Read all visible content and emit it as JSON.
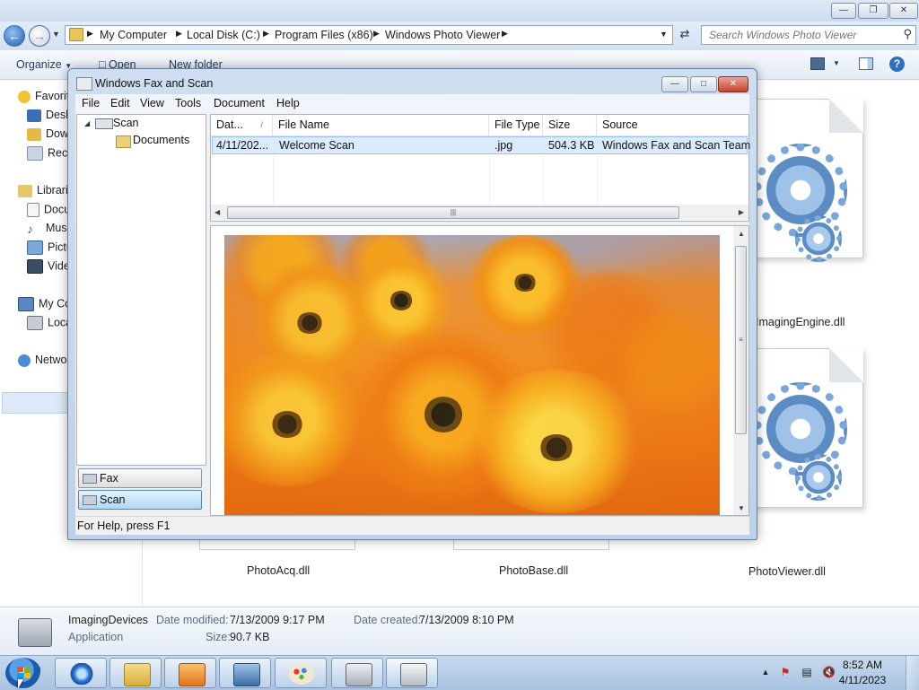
{
  "explorer": {
    "address": {
      "crumbs": [
        "My Computer",
        "Local Disk (C:)",
        "Program Files (x86)",
        "Windows Photo Viewer"
      ]
    },
    "search_placeholder": "Search Windows Photo Viewer",
    "toolbar": {
      "organize": "Organize",
      "open": "Open",
      "new_folder": "New folder"
    },
    "nav": {
      "favorites": "Favorites",
      "desktop": "Desktop",
      "downloads": "Downloads",
      "recent": "Recent Places",
      "libraries": "Libraries",
      "documents": "Documents",
      "music": "Music",
      "pictures": "Pictures",
      "videos": "Videos",
      "computer": "My Computer",
      "local_disk": "Local Disk (C:)",
      "network": "Network"
    },
    "files": {
      "imaging_engine": "ImagingEngine.dll",
      "photo_viewer": "PhotoViewer.dll",
      "photo_acq": "PhotoAcq.dll",
      "photo_base": "PhotoBase.dll"
    },
    "details": {
      "name": "ImagingDevices",
      "type": "Application",
      "modified_label": "Date modified:",
      "modified_value": "7/13/2009 9:17 PM",
      "created_label": "Date created:",
      "created_value": "7/13/2009 8:10 PM",
      "size_label": "Size:",
      "size_value": "90.7 KB"
    }
  },
  "fax": {
    "title": "Windows Fax and Scan",
    "menu": [
      "File",
      "Edit",
      "View",
      "Tools",
      "Document",
      "Help"
    ],
    "tree": {
      "scan": "Scan",
      "documents": "Documents"
    },
    "buttons": {
      "fax": "Fax",
      "scan": "Scan"
    },
    "columns": [
      "Dat...",
      "File Name",
      "File Type",
      "Size",
      "Source"
    ],
    "rows": [
      {
        "date": "4/11/202...",
        "name": "Welcome Scan",
        "type": ".jpg",
        "size": "504.3 KB",
        "source": "Windows Fax and Scan Team"
      }
    ],
    "status": "For Help, press F1"
  },
  "taskbar": {
    "time": "8:52 AM",
    "date": "4/11/2023",
    "apps": [
      "internet-explorer",
      "windows-explorer",
      "media-player",
      "photo-viewer",
      "paint",
      "scanner",
      "fax-and-scan"
    ]
  }
}
